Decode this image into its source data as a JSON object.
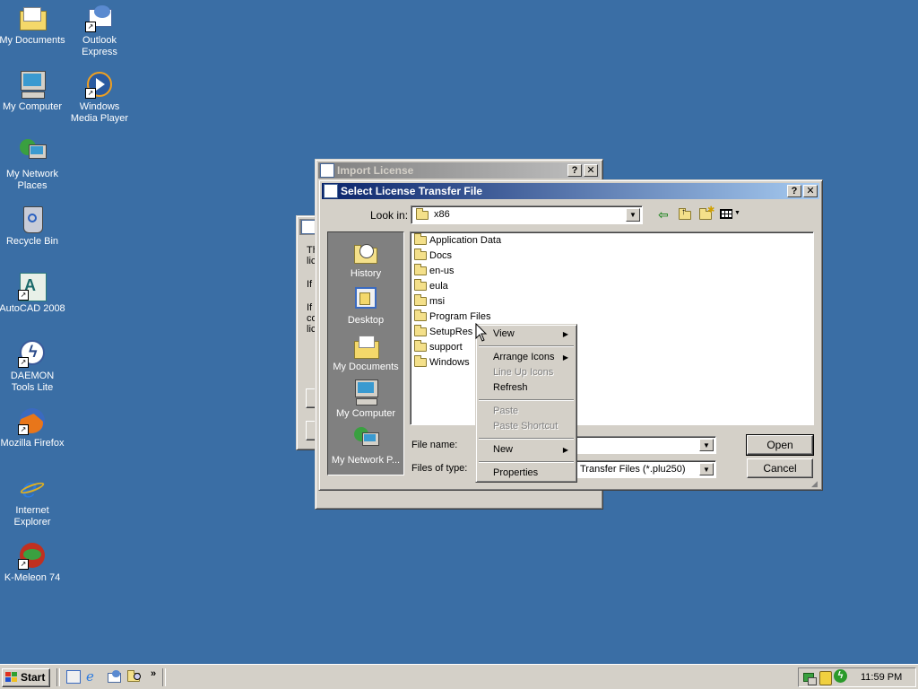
{
  "desktop": {
    "icons": [
      {
        "label": "My Documents",
        "icon": "my-documents-icon"
      },
      {
        "label": "Outlook Express",
        "icon": "outlook-express-icon"
      },
      {
        "label": "My Computer",
        "icon": "my-computer-icon"
      },
      {
        "label": "Windows Media Player",
        "icon": "windows-media-player-icon"
      },
      {
        "label": "My Network Places",
        "icon": "network-places-icon"
      },
      {
        "label": "Recycle Bin",
        "icon": "recycle-bin-icon"
      },
      {
        "label": "AutoCAD 2008",
        "icon": "autocad-icon"
      },
      {
        "label": "DAEMON Tools Lite",
        "icon": "daemon-tools-icon"
      },
      {
        "label": "Mozilla Firefox",
        "icon": "firefox-icon"
      },
      {
        "label": "Internet Explorer",
        "icon": "internet-explorer-icon"
      },
      {
        "label": "K-Meleon 74",
        "icon": "k-meleon-icon"
      }
    ]
  },
  "background_window": {
    "text_lines": [
      "Th",
      "lic",
      "If",
      "If",
      "co",
      "lic"
    ]
  },
  "import_window": {
    "title": "Import License"
  },
  "dialog": {
    "title": "Select License Transfer File",
    "look_in_label": "Look in:",
    "look_in_value": "x86",
    "files": [
      "Application Data",
      "Docs",
      "en-us",
      "eula",
      "msi",
      "Program Files",
      "SetupRes",
      "support",
      "Windows"
    ],
    "places": [
      "History",
      "Desktop",
      "My Documents",
      "My Computer",
      "My Network P..."
    ],
    "file_name_label": "File name:",
    "file_name_value": "",
    "files_of_type_label": "Files of type:",
    "files_of_type_value": "Transfer Files (*.plu250)",
    "open_label": "Open",
    "cancel_label": "Cancel"
  },
  "context_menu": {
    "items": [
      {
        "label": "View",
        "enabled": true,
        "submenu": true
      },
      {
        "label": "Arrange Icons",
        "enabled": true,
        "submenu": true
      },
      {
        "label": "Line Up Icons",
        "enabled": false,
        "submenu": false
      },
      {
        "label": "Refresh",
        "enabled": true,
        "submenu": false
      },
      {
        "label": "Paste",
        "enabled": false,
        "submenu": false
      },
      {
        "label": "Paste Shortcut",
        "enabled": false,
        "submenu": false
      },
      {
        "label": "New",
        "enabled": true,
        "submenu": true
      },
      {
        "label": "Properties",
        "enabled": true,
        "submenu": false
      }
    ]
  },
  "taskbar": {
    "start_label": "Start",
    "clock": "11:59 PM"
  },
  "colors": {
    "desktop": "#3a6ea5",
    "title_active": "#0a246a",
    "face": "#d4d0c8"
  }
}
